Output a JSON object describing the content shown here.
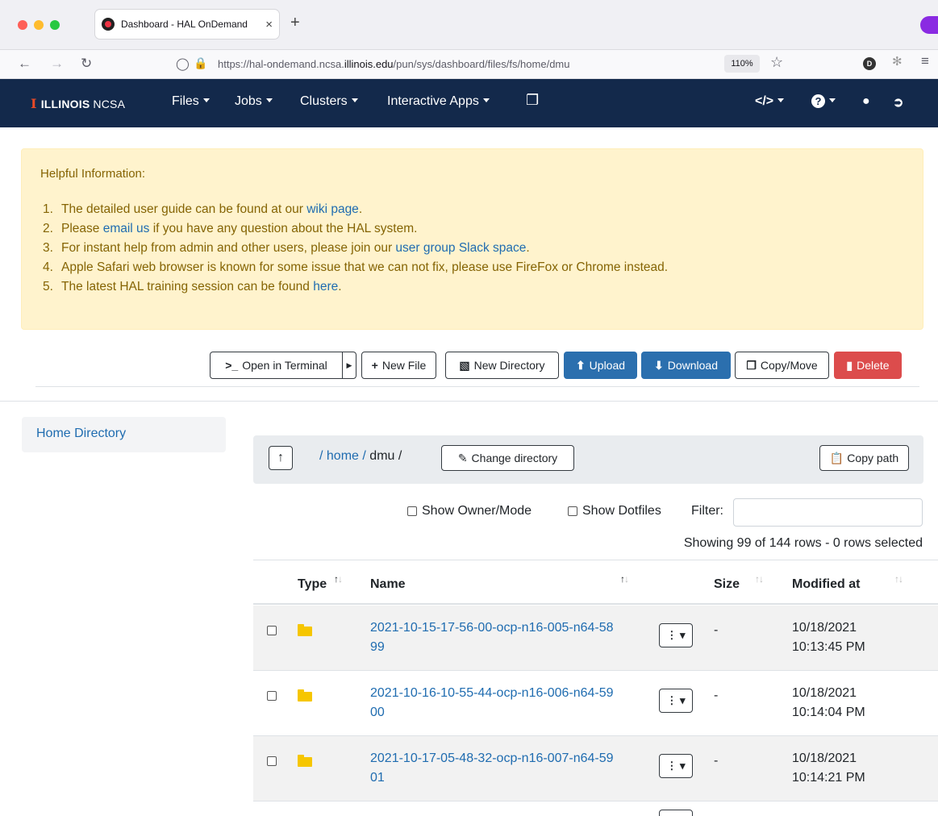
{
  "browser": {
    "tab_title": "Dashboard - HAL OnDemand",
    "tab_close": "×",
    "new_tab": "+",
    "url_prefix": "https://hal-ondemand.ncsa.",
    "url_domain": "illinois.edu",
    "url_path": "/pun/sys/dashboard/files/fs/home/dmu",
    "zoom": "110%",
    "profile_initial": "D"
  },
  "navbar": {
    "brand_bold": "ILLINOIS",
    "brand_light": "NCSA",
    "brand_mark": "I",
    "items": [
      "Files",
      "Jobs",
      "Clusters",
      "Interactive Apps"
    ],
    "dev_icon": "</>",
    "help_icon": "?",
    "icons": [
      "copy-icon",
      "code-icon",
      "help-icon",
      "user-icon",
      "logout-icon"
    ]
  },
  "alert": {
    "title": "Helpful Information:",
    "items": [
      {
        "num": "1.",
        "pre": "The detailed user guide can be found at our ",
        "link": "wiki page",
        "post": "."
      },
      {
        "num": "2.",
        "pre": "Please ",
        "link": "email us",
        "post": " if you have any question about the HAL system."
      },
      {
        "num": "3.",
        "pre": "For instant help from admin and other users, please join our ",
        "link": "user group Slack space",
        "post": "."
      },
      {
        "num": "4.",
        "pre": "Apple Safari web browser is known for some issue that we can not fix, please use FireFox or Chrome instead.",
        "link": "",
        "post": ""
      },
      {
        "num": "5.",
        "pre": "The latest HAL training session can be found ",
        "link": "here",
        "post": "."
      }
    ]
  },
  "toolbar": {
    "open_terminal": "Open in Terminal",
    "new_file": "New File",
    "new_directory": "New Directory",
    "upload": "Upload",
    "download": "Download",
    "copy_move": "Copy/Move",
    "delete": "Delete"
  },
  "sidebar": {
    "home": "Home Directory"
  },
  "breadcrumb": {
    "sep1": "/",
    "home": "home",
    "sep2": "/",
    "current": "dmu /",
    "change_directory": "Change directory",
    "copy_path": "Copy path"
  },
  "options": {
    "show_owner": "Show Owner/Mode",
    "show_dotfiles": "Show Dotfiles",
    "filter_label": "Filter:",
    "filter_value": "",
    "showing": "Showing 99 of 144 rows - 0 rows selected"
  },
  "table": {
    "headers": {
      "type": "Type",
      "name": "Name",
      "size": "Size",
      "modified": "Modified at"
    },
    "rows": [
      {
        "name": "2021-10-15-17-56-00-ocp-n16-005-n64-5899",
        "size": "-",
        "date": "10/18/2021",
        "time": "10:13:45 PM"
      },
      {
        "name": "2021-10-16-10-55-44-ocp-n16-006-n64-5900",
        "size": "-",
        "date": "10/18/2021",
        "time": "10:14:04 PM"
      },
      {
        "name": "2021-10-17-05-48-32-ocp-n16-007-n64-5901",
        "size": "-",
        "date": "10/18/2021",
        "time": "10:14:21 PM"
      }
    ]
  }
}
